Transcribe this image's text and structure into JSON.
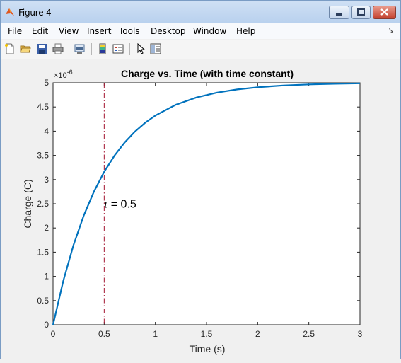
{
  "window": {
    "title": "Figure 4",
    "controls": [
      "minimize",
      "maximize",
      "close"
    ]
  },
  "menu": {
    "items": [
      "File",
      "Edit",
      "View",
      "Insert",
      "Tools",
      "Desktop",
      "Window",
      "Help"
    ],
    "overflow_symbol": "↘"
  },
  "toolbar": {
    "icons": [
      "new-figure-icon",
      "open-file-icon",
      "save-icon",
      "print-icon",
      "link-plot-icon",
      "insert-colorbar-icon",
      "insert-legend-icon",
      "edit-plot-icon",
      "property-inspector-icon"
    ]
  },
  "chart_data": {
    "type": "line",
    "title": "Charge vs. Time (with time constant)",
    "xlabel": "Time (s)",
    "ylabel": "Charge (C)",
    "xlim": [
      0,
      3
    ],
    "ylim": [
      0,
      5
    ],
    "y_exponent_label": "×10",
    "y_exponent_power": "-6",
    "xticks": [
      0,
      0.5,
      1,
      1.5,
      2,
      2.5,
      3
    ],
    "xtick_labels": [
      "0",
      "0.5",
      "1",
      "1.5",
      "2",
      "2.5",
      "3"
    ],
    "yticks": [
      0,
      0.5,
      1,
      1.5,
      2,
      2.5,
      3,
      3.5,
      4,
      4.5,
      5
    ],
    "ytick_labels": [
      "0",
      "0.5",
      "1",
      "1.5",
      "2",
      "2.5",
      "3",
      "3.5",
      "4",
      "4.5",
      "5"
    ],
    "series": [
      {
        "color": "#0072bd",
        "x": [
          0,
          0.1,
          0.2,
          0.3,
          0.4,
          0.5,
          0.6,
          0.7,
          0.8,
          0.9,
          1.0,
          1.2,
          1.4,
          1.6,
          1.8,
          2.0,
          2.25,
          2.5,
          2.75,
          3.0
        ],
        "y": [
          0,
          0.906,
          1.648,
          2.256,
          2.753,
          3.161,
          3.494,
          3.767,
          3.991,
          4.174,
          4.323,
          4.546,
          4.696,
          4.796,
          4.863,
          4.908,
          4.944,
          4.966,
          4.98,
          4.988
        ]
      }
    ],
    "vline": {
      "x": 0.5,
      "color": "#a2142f",
      "style": "dash-dot"
    },
    "annotation": {
      "symbol": "τ",
      "text": " = 0.5",
      "x": 0.5,
      "y": 2.45
    },
    "grid": false,
    "legend": "none"
  }
}
